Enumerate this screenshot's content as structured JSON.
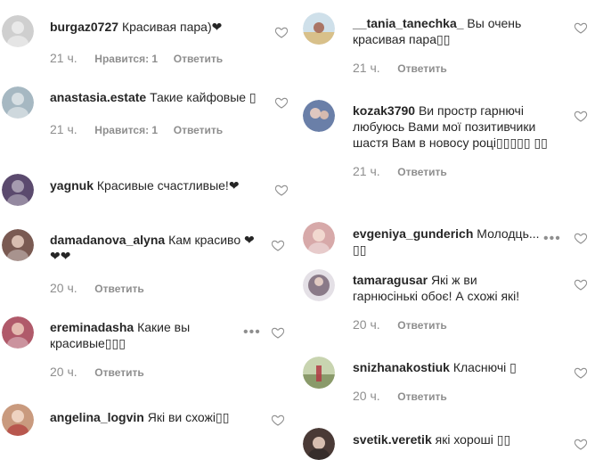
{
  "left_column": [
    {
      "username": "burgaz0727",
      "text": "Красивая пара)❤",
      "time": "21 ч.",
      "likes": "Нравится: 1",
      "reply": "Ответить",
      "avatar_color": "#cfcfcf"
    },
    {
      "username": "anastasia.estate",
      "text": "Такие кайфовые ▯",
      "time": "21 ч.",
      "likes": "Нравится: 1",
      "reply": "Ответить",
      "avatar_color": "#a6b8c2"
    },
    {
      "username": "yagnuk",
      "text": "Красивые счастливые!❤",
      "avatar_color": "#5b4a6e"
    },
    {
      "username": "damadanova_alyna",
      "text": "Кам красиво ❤❤❤",
      "time": "20 ч.",
      "reply": "Ответить",
      "avatar_color": "#7a5a52"
    },
    {
      "username": "ereminadasha",
      "text": "Какие вы красивые▯▯▯",
      "time": "20 ч.",
      "reply": "Ответить",
      "avatar_color": "#b05a6a"
    },
    {
      "username": "angelina_logvin",
      "text": "Які ви схожі▯▯",
      "avatar_color": "#c99a7e"
    }
  ],
  "right_column": [
    {
      "username": "__tania_tanechka_",
      "text": "Вы очень красивая пара▯▯",
      "time": "21 ч.",
      "reply": "Ответить",
      "avatar_color": "#d8c08a"
    },
    {
      "username": "kozak3790",
      "text": "Ви простр гарнючі любуюсь Вами мої позитивчики шастя Вам в новосу році▯▯▯▯▯ ▯▯",
      "time": "21 ч.",
      "reply": "Ответить",
      "avatar_color": "#6a7fa8"
    },
    {
      "username": "evgeniya_gunderich",
      "text": "Молодць... ▯▯",
      "avatar_color": "#d7a9a9"
    },
    {
      "username": "tamaragusar",
      "text": "Які ж ви гарнюсінькі обоє! А схожі які!",
      "time": "20 ч.",
      "reply": "Ответить",
      "avatar_color": "#8a7a88"
    },
    {
      "username": "snizhanakostiuk",
      "text": "Класнючі ▯",
      "time": "20 ч.",
      "reply": "Ответить",
      "avatar_color": "#8a9a6a"
    },
    {
      "username": "svetik.veretik",
      "text": "які хороші ▯▯",
      "avatar_color": "#4a3a36"
    }
  ],
  "icons": {
    "like": "heart-outline-icon",
    "more": "more-options-icon",
    "more_glyph": "•••"
  },
  "colors": {
    "text": "#262626",
    "muted": "#8e8e8e",
    "heart_stroke": "#8e8e8e"
  }
}
